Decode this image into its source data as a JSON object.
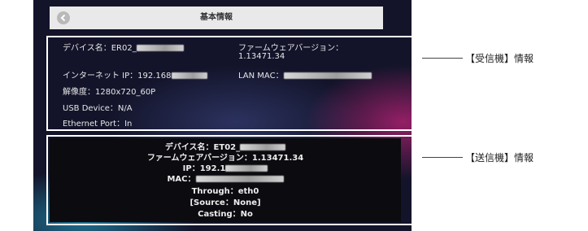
{
  "header": {
    "title": "基本情報"
  },
  "receiver": {
    "device_name_label": "デバイス名：ER02_",
    "firmware_label": "ファームウェアバージョン：",
    "firmware_value": "1.13471.34",
    "internet_ip_label": "インターネット IP：192.168",
    "lan_mac_label": "LAN MAC：",
    "resolution": "解像度：1280x720_60P",
    "usb_device": "USB Device：N/A",
    "ethernet_port": "Ethernet Port：In"
  },
  "sender": {
    "device_name": "デバイス名：ET02_",
    "firmware": "ファームウェアバージョン：1.13471.34",
    "ip": "IP：192.1",
    "mac": "MAC：",
    "through": "Through：eth0",
    "source": "[Source：None]",
    "casting": "Casting：No"
  },
  "annotations": {
    "receiver_label": "【受信機】情報",
    "sender_label": "【送信機】情報"
  }
}
